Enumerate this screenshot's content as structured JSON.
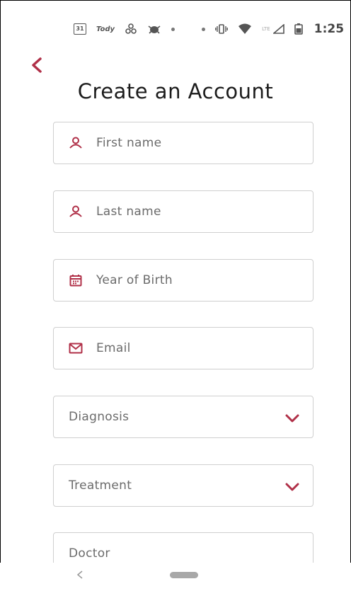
{
  "status_bar": {
    "calendar_text": "31",
    "app_text": "Tody",
    "time": "1:25",
    "network_label": "LTE"
  },
  "header": {
    "title": "Create an Account"
  },
  "form": {
    "first_name": {
      "placeholder": "First name",
      "icon": "person-icon"
    },
    "last_name": {
      "placeholder": "Last name",
      "icon": "person-icon"
    },
    "year_of_birth": {
      "placeholder": "Year of Birth",
      "icon": "calendar-icon"
    },
    "email": {
      "placeholder": "Email",
      "icon": "mail-icon"
    },
    "diagnosis": {
      "placeholder": "Diagnosis",
      "icon": "chevron-down-icon"
    },
    "treatment": {
      "placeholder": "Treatment",
      "icon": "chevron-down-icon"
    },
    "doctor": {
      "placeholder": "Doctor"
    }
  },
  "colors": {
    "accent": "#b03048",
    "border": "#cfcfcf",
    "text": "#1c1c1c",
    "placeholder": "#6b6b6b"
  }
}
